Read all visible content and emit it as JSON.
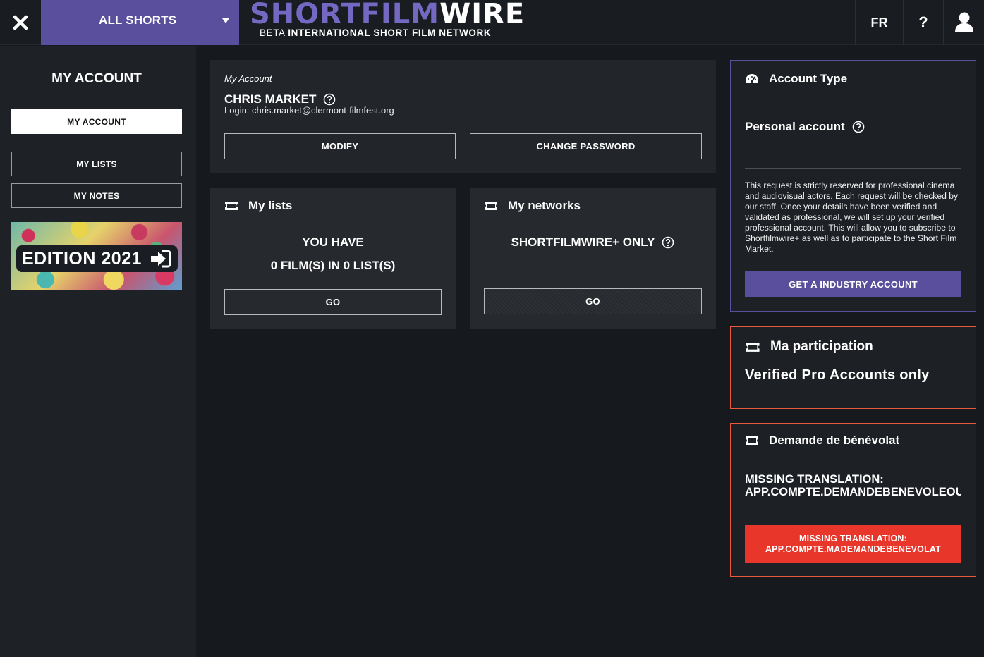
{
  "topbar": {
    "category_dropdown": "ALL SHORTS",
    "logo_main_left": "SHORTFILM",
    "logo_main_right": "WIRE",
    "logo_beta": "BETA",
    "logo_tagline": "INTERNATIONAL SHORT FILM NETWORK",
    "language": "FR",
    "help": "?"
  },
  "sidebar": {
    "title": "MY ACCOUNT",
    "items": [
      {
        "label": "MY ACCOUNT",
        "active": true
      },
      {
        "label": "MY LISTS",
        "active": false
      },
      {
        "label": "MY NOTES",
        "active": false
      }
    ],
    "banner_text": "EDITION 2021"
  },
  "account": {
    "breadcrumb": "My Account",
    "name": "CHRIS MARKET",
    "login": "Login: chris.market@clermont-filmfest.org",
    "modify_label": "MODIFY",
    "change_password_label": "CHANGE PASSWORD"
  },
  "my_lists": {
    "title": "My lists",
    "line1": "YOU HAVE",
    "line2": "0 FILM(S) IN 0 LIST(S)",
    "go_label": "GO"
  },
  "my_networks": {
    "title": "My networks",
    "text": "SHORTFILMWIRE+ ONLY",
    "go_label": "GO"
  },
  "account_type": {
    "title": "Account Type",
    "value": "Personal account",
    "description": "This request is strictly reserved for professional cinema and audiovisual actors. Each request will be checked by our staff. Once your details have been verified and validated as professional, we will set up your verified professional account. This will allow you to subscribe to Shortfilmwire+ as well as to participate to the Short Film Market.",
    "button_label": "GET A INDUSTRY ACCOUNT"
  },
  "participation": {
    "title": "Ma participation",
    "text": "Verified Pro Accounts only"
  },
  "benevolat": {
    "title": "Demande de bénévolat",
    "missing_line1": "MISSING TRANSLATION:",
    "missing_line2": "APP.COMPTE.DEMANDEBENEVOLEOUVERT",
    "button_line1": "MISSING TRANSLATION:",
    "button_line2": "APP.COMPTE.MADEMANDEBENEVOLAT"
  },
  "colors": {
    "accent": "#5a4f9c",
    "warning_border": "#ea5a3a",
    "danger": "#e8362b",
    "background": "#16191d"
  }
}
